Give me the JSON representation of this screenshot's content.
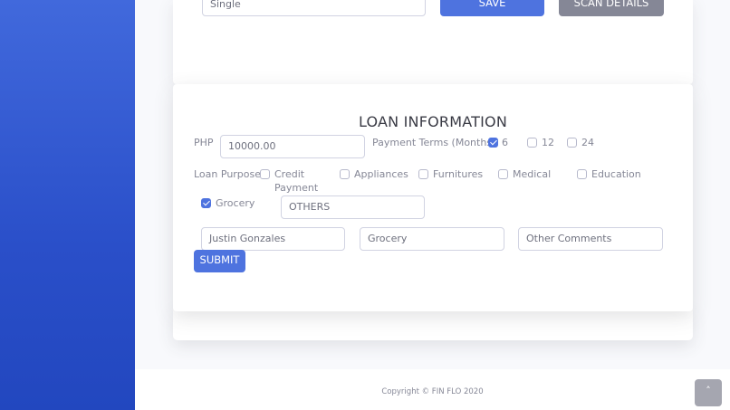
{
  "top_form": {
    "civil_status_value": "Single",
    "save_label": "SAVE",
    "scan_label": "SCAN DETAILS"
  },
  "loan": {
    "title": "LOAN INFORMATION",
    "currency_label": "PHP",
    "amount_value": "10000.00",
    "terms_label": "Payment Terms (Months)",
    "terms": [
      {
        "label": "6",
        "checked": true
      },
      {
        "label": "12",
        "checked": false
      },
      {
        "label": "24",
        "checked": false
      }
    ],
    "purpose_label": "Loan Purpose",
    "purposes": {
      "credit_line1": "Credit",
      "credit_line2": "Payment",
      "appliances": "Appliances",
      "furnitures": "Furnitures",
      "medical": "Medical",
      "education": "Education",
      "grocery": "Grocery"
    },
    "others_value": "OTHERS",
    "name_value": "Justin Gonzales",
    "purpose_value": "Grocery",
    "comments_placeholder": "Other Comments",
    "submit_label": "SUBMIT"
  },
  "footer": {
    "copyright": "Copyright © FIN FLO 2020",
    "scroll_top_glyph": "˄"
  },
  "colors": {
    "primary": "#4e73df",
    "secondary": "#858796",
    "sidebar": "#2a4fc9"
  }
}
